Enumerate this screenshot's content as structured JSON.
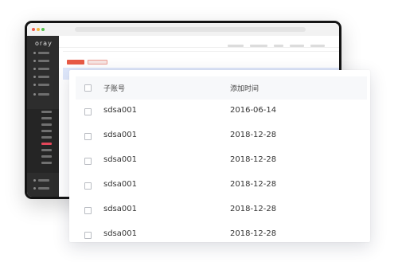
{
  "background_window": {
    "logo_text": "oray",
    "traffic_lights": [
      "#ee5a4c",
      "#f3b83b",
      "#53c049"
    ],
    "accent_color": "#e4475a",
    "primary_button_color": "#e85a45"
  },
  "table": {
    "header": {
      "select_all": false,
      "account_label": "子账号",
      "time_label": "添加时间"
    },
    "rows": [
      {
        "account": "sdsa001",
        "added": "2016-06-14",
        "selected": false
      },
      {
        "account": "sdsa001",
        "added": "2018-12-28",
        "selected": false
      },
      {
        "account": "sdsa001",
        "added": "2018-12-28",
        "selected": false
      },
      {
        "account": "sdsa001",
        "added": "2018-12-28",
        "selected": false
      },
      {
        "account": "sdsa001",
        "added": "2018-12-28",
        "selected": false
      },
      {
        "account": "sdsa001",
        "added": "2018-12-28",
        "selected": false
      }
    ]
  }
}
